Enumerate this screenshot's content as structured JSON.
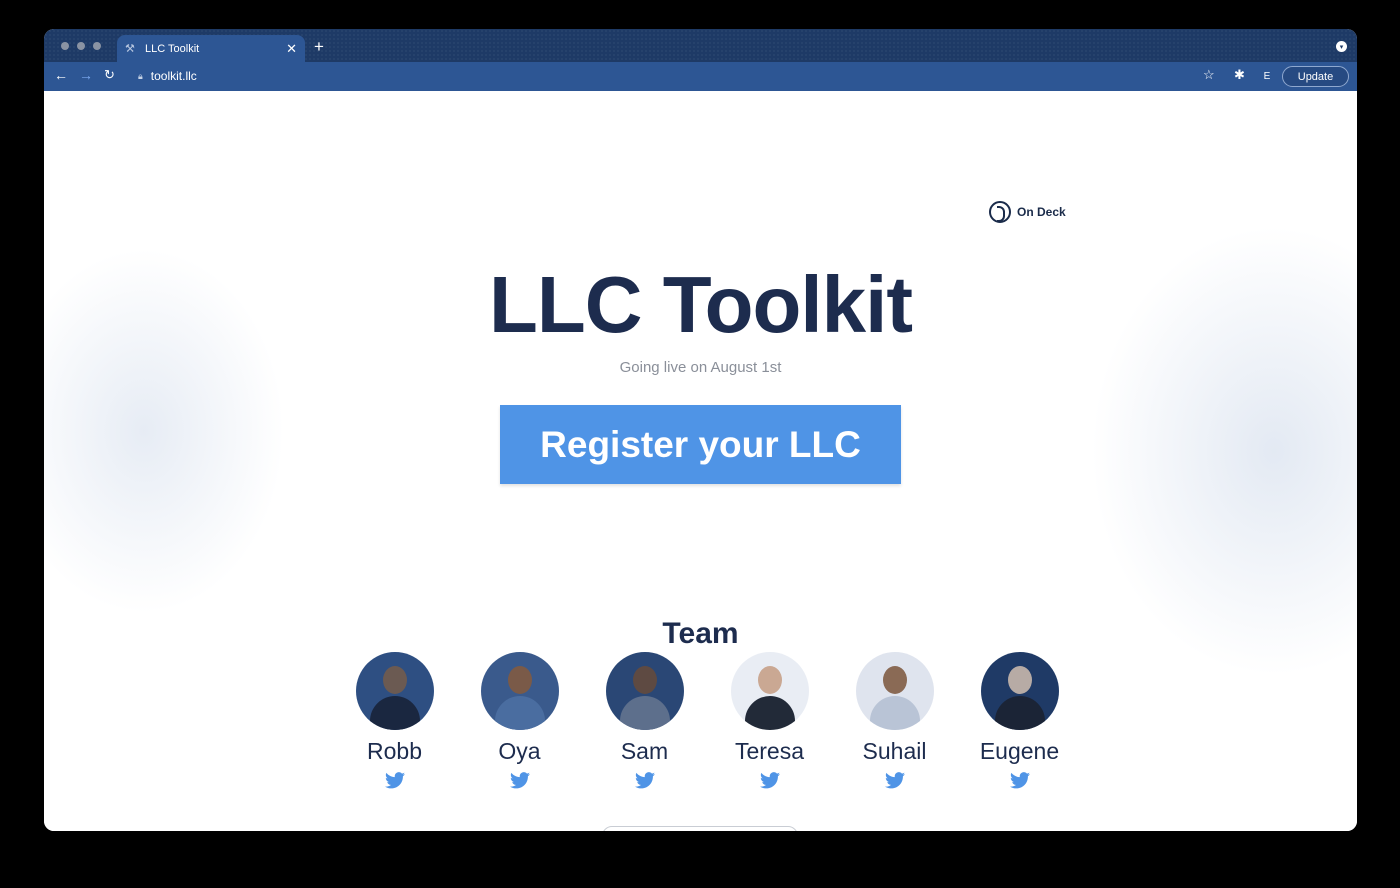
{
  "browser": {
    "tab_title": "LLC Toolkit",
    "url": "toolkit.llc",
    "update_label": "Update",
    "profile_initial": "E",
    "accent_color": "#2d5694"
  },
  "brand": {
    "partner_label": "On Deck"
  },
  "hero": {
    "title": "LLC Toolkit",
    "subtitle": "Going live on August 1st",
    "cta_label": "Register your LLC",
    "cta_color": "#4f94e6"
  },
  "team": {
    "heading": "Team",
    "members": [
      {
        "name": "Robb"
      },
      {
        "name": "Oya"
      },
      {
        "name": "Sam"
      },
      {
        "name": "Teresa"
      },
      {
        "name": "Suhail"
      },
      {
        "name": "Eugene"
      }
    ]
  }
}
